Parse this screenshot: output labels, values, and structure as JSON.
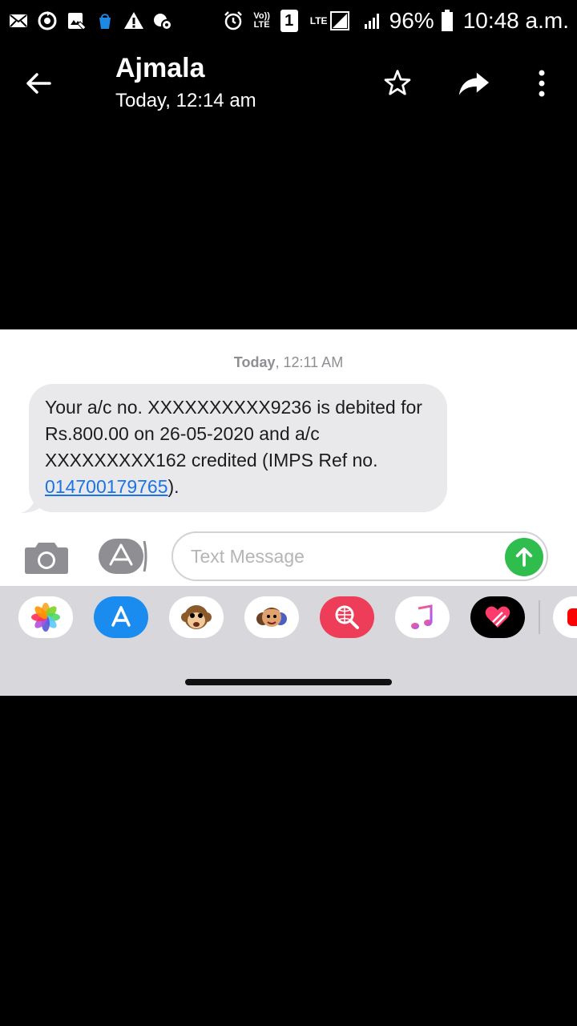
{
  "status_bar": {
    "battery": "96%",
    "time": "10:48 a.m.",
    "sim_slot": "1",
    "volte_label": "Vo))",
    "volte_sub": "LTE",
    "lte_label": "LTE",
    "left_icons": [
      "mail-icon",
      "sync-icon",
      "image-icon",
      "shopping-bag-icon",
      "warning-icon",
      "cloud-settings-icon"
    ],
    "right_icons": [
      "alarm-icon",
      "volte-icon",
      "sim-icon",
      "lte-icon",
      "signal-icon",
      "battery-icon"
    ]
  },
  "appbar": {
    "title": "Ajmala",
    "subtitle": "Today, 12:14 am",
    "actions": [
      "back-arrow-icon",
      "star-icon",
      "share-icon",
      "more-vert-icon"
    ]
  },
  "screenshot": {
    "timestamp_day": "Today",
    "timestamp_time": ", 12:11 AM",
    "message_text": "Your a/c no. XXXXXXXXXX9236 is debited for Rs.800.00 on 26-05-2020 and a/c XXXXXXXXX162 credited (IMPS Ref no. ",
    "message_link": "014700179765",
    "message_end": ").",
    "input_placeholder": "Text Message",
    "drawer_apps": [
      "photos-app-icon",
      "app-store-icon",
      "memoji-monkey-icon",
      "memoji-stickers-icon",
      "web-search-icon",
      "music-icon",
      "digital-touch-icon",
      "video-app-icon"
    ]
  },
  "colors": {
    "send_button": "#2fbe4d",
    "link": "#1a73e8",
    "bubble": "#e9e9eb",
    "drawer": "#d8d8dc"
  }
}
